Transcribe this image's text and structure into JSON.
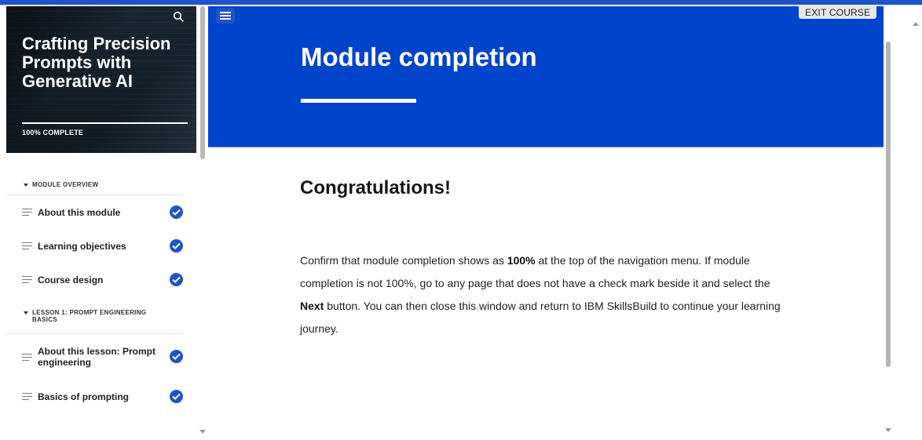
{
  "course": {
    "title": "Crafting Precision Prompts with Generative AI",
    "progress_text": "100% COMPLETE"
  },
  "nav": {
    "sections": [
      {
        "label": "MODULE OVERVIEW",
        "items": [
          {
            "label": "About this module",
            "completed": true
          },
          {
            "label": "Learning objectives",
            "completed": true
          },
          {
            "label": "Course design",
            "completed": true
          }
        ]
      },
      {
        "label": "LESSON 1: PROMPT ENGINEERING BASICS",
        "items": [
          {
            "label": "About this lesson: Prompt engineering",
            "completed": true
          },
          {
            "label": "Basics of prompting",
            "completed": true
          }
        ]
      }
    ]
  },
  "header": {
    "exit_label": "EXIT COURSE",
    "title": "Module completion"
  },
  "content": {
    "heading": "Congratulations!",
    "p1": "Confirm that module completion shows as ",
    "p1_bold": "100%",
    "p2": " at the top of the navigation menu. If module completion is not 100%, go to any page that does not have a check mark beside it and select the ",
    "p2_bold": "Next",
    "p3": " button. You can then close this window and return to IBM SkillsBuild to continue your learning journey."
  },
  "colors": {
    "brand_blue": "#0044cc",
    "check_blue": "#1f53c9"
  }
}
